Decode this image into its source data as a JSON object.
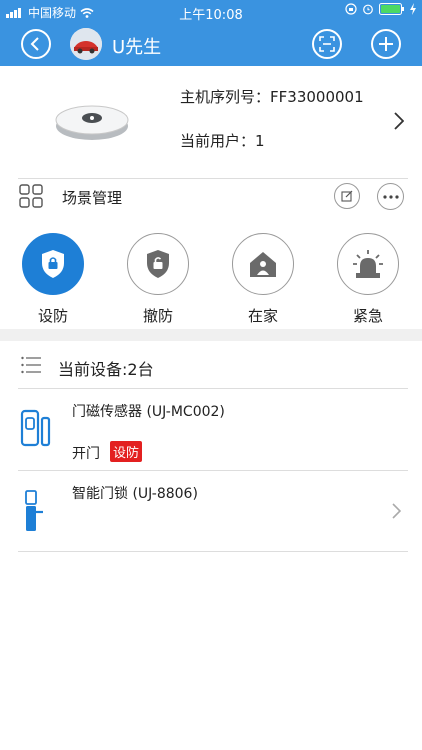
{
  "status_bar": {
    "carrier": "中国移动",
    "time": "上午10:08"
  },
  "nav": {
    "title": "U先生"
  },
  "hub": {
    "serial_label": "主机序列号：",
    "serial_value": "FF33000001",
    "user_label": "当前用户：",
    "user_value": "1"
  },
  "scene": {
    "title": "场景管理"
  },
  "modes": [
    {
      "label": "设防",
      "active": true
    },
    {
      "label": "撤防",
      "active": false
    },
    {
      "label": "在家",
      "active": false
    },
    {
      "label": "紧急",
      "active": false
    }
  ],
  "devices_header": "当前设备:2台",
  "devices": [
    {
      "name": "门磁传感器 (UJ-MC002)",
      "status": "开门",
      "badge": "设防"
    },
    {
      "name": "智能门锁 (UJ-8806)"
    }
  ],
  "colors": {
    "brand": "#3a93e0",
    "active": "#1e7fd6",
    "badge": "#e32020"
  }
}
